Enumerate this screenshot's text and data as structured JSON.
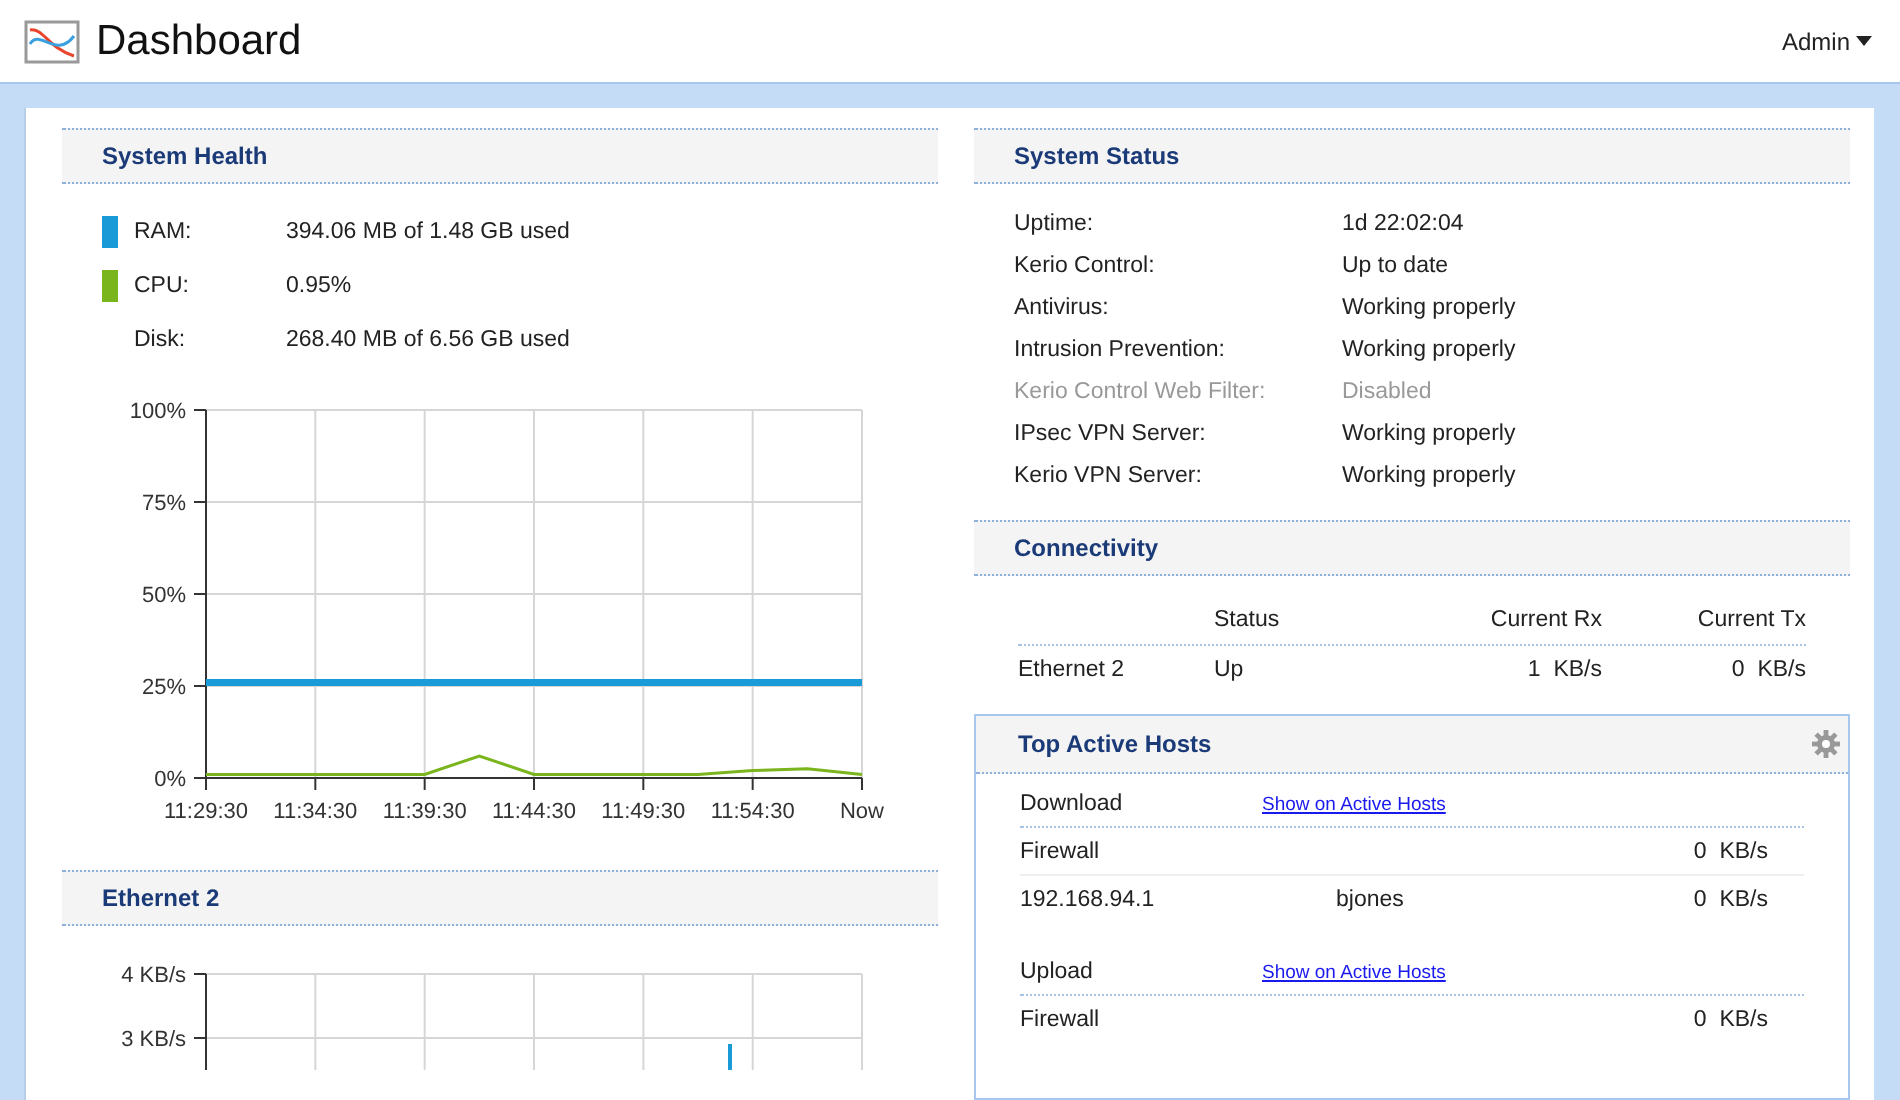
{
  "header": {
    "title": "Dashboard",
    "user_menu": "Admin"
  },
  "system_health": {
    "title": "System Health",
    "metrics": [
      {
        "label": "RAM:",
        "value": "394.06 MB of 1.48 GB used",
        "color": "#1a9ad6"
      },
      {
        "label": "CPU:",
        "value": "0.95%",
        "color": "#7ab51d"
      },
      {
        "label": "Disk:",
        "value": "268.40 MB of 6.56 GB used"
      }
    ],
    "chart_data": {
      "type": "line",
      "grid": true,
      "categories": [
        "11:29:30",
        null,
        "11:34:30",
        null,
        "11:39:30",
        null,
        "11:44:30",
        null,
        "11:49:30",
        null,
        "11:54:30",
        null,
        "Now"
      ],
      "ylim": [
        0,
        100
      ],
      "yticks": [
        {
          "value": 0,
          "label": "0%"
        },
        {
          "value": 25,
          "label": "25%"
        },
        {
          "value": 50,
          "label": "50%"
        },
        {
          "value": 75,
          "label": "75%"
        },
        {
          "value": 100,
          "label": "100%"
        }
      ],
      "series": [
        {
          "color": "#1a9ad6",
          "values": [
            26,
            26,
            26,
            26,
            26,
            26,
            26,
            26,
            26,
            26,
            26,
            26,
            26
          ]
        },
        {
          "color": "#7ab51d",
          "values": [
            1,
            1,
            1,
            1,
            1,
            6,
            1,
            1,
            1,
            1,
            2,
            2.5,
            1
          ]
        }
      ]
    }
  },
  "ethernet": {
    "title": "Ethernet 2",
    "axis_labels": [
      "4 KB/s",
      "3 KB/s"
    ]
  },
  "system_status": {
    "title": "System Status",
    "rows": [
      {
        "label": "Uptime:",
        "value": "1d 22:02:04",
        "disabled": false
      },
      {
        "label": "Kerio Control:",
        "value": "Up to date",
        "disabled": false
      },
      {
        "label": "Antivirus:",
        "value": "Working properly",
        "disabled": false
      },
      {
        "label": "Intrusion Prevention:",
        "value": "Working properly",
        "disabled": false
      },
      {
        "label": "Kerio Control Web Filter:",
        "value": "Disabled",
        "disabled": true
      },
      {
        "label": "IPsec VPN Server:",
        "value": "Working properly",
        "disabled": false
      },
      {
        "label": "Kerio VPN Server:",
        "value": "Working properly",
        "disabled": false
      }
    ]
  },
  "connectivity": {
    "title": "Connectivity",
    "columns": [
      "Status",
      "Current Rx",
      "Current Tx"
    ],
    "rows": [
      {
        "name": "Ethernet 2",
        "status": "Up",
        "rx": "1  KB/s",
        "tx": "0  KB/s"
      }
    ]
  },
  "top_active_hosts": {
    "title": "Top Active Hosts",
    "groups": [
      {
        "title": "Download",
        "link": "Show on Active Hosts",
        "rows": [
          {
            "host": "Firewall",
            "rate": "0  KB/s"
          },
          {
            "host": "192.168.94.1",
            "user": "bjones",
            "rate": "0  KB/s"
          }
        ]
      },
      {
        "title": "Upload",
        "link": "Show on Active Hosts",
        "rows": [
          {
            "host": "Firewall",
            "rate": "0  KB/s"
          }
        ]
      }
    ]
  }
}
